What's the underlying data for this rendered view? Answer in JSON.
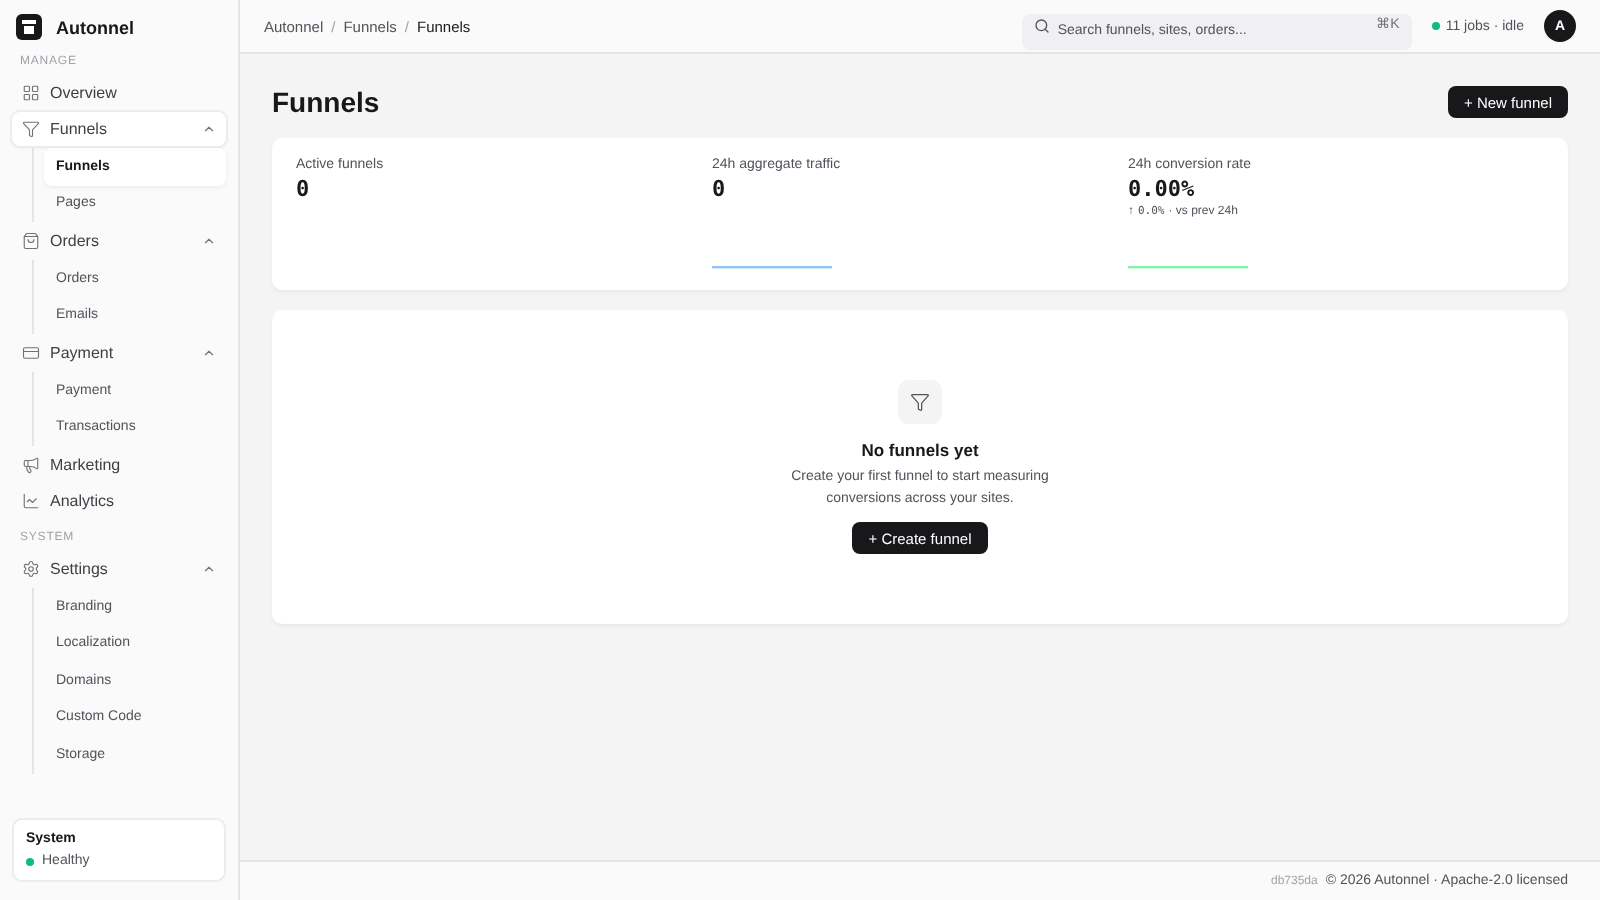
{
  "brand": {
    "name": "Autonnel"
  },
  "sidebar": {
    "sections": [
      {
        "title": "MANAGE",
        "items": [
          {
            "label": "Overview",
            "selected": false
          },
          {
            "label": "Funnels",
            "selected": true,
            "expanded": true,
            "children": [
              {
                "label": "Funnels",
                "selected": true
              },
              {
                "label": "Pages",
                "selected": false
              }
            ]
          },
          {
            "label": "Orders",
            "selected": false,
            "expanded": true,
            "children": [
              {
                "label": "Orders",
                "selected": false
              },
              {
                "label": "Emails",
                "selected": false
              }
            ]
          },
          {
            "label": "Payment",
            "selected": false,
            "expanded": true,
            "children": [
              {
                "label": "Payment",
                "selected": false
              },
              {
                "label": "Transactions",
                "selected": false
              }
            ]
          },
          {
            "label": "Marketing",
            "selected": false
          },
          {
            "label": "Analytics",
            "selected": false
          }
        ]
      },
      {
        "title": "SYSTEM",
        "items": [
          {
            "label": "Settings",
            "selected": false,
            "expanded": true,
            "children": [
              {
                "label": "Branding",
                "selected": false
              },
              {
                "label": "Localization",
                "selected": false
              },
              {
                "label": "Domains",
                "selected": false
              },
              {
                "label": "Custom Code",
                "selected": false
              },
              {
                "label": "Storage",
                "selected": false
              }
            ]
          }
        ]
      }
    ],
    "status_card": {
      "title": "System",
      "status": "Healthy",
      "color": "#10b981"
    }
  },
  "header": {
    "breadcrumbs": [
      "Autonnel",
      "Funnels",
      "Funnels"
    ],
    "breadcrumb_separator": "/",
    "search": {
      "placeholder": "Search funnels, sites, orders...",
      "shortcut": "⌘K"
    },
    "jobs": {
      "text": "11 jobs · idle",
      "color": "#10b981"
    },
    "avatar": "A"
  },
  "page": {
    "title": "Funnels",
    "action": "+ New funnel"
  },
  "metrics": [
    {
      "label": "Active funnels",
      "value": "0"
    },
    {
      "label": "24h aggregate traffic",
      "value": "0",
      "sparkline": {
        "color": "#93c5fd"
      }
    },
    {
      "label": "24h conversion rate",
      "value": "0.00%",
      "delta": {
        "arrow": "↑",
        "value": "0.0%",
        "text": "· vs prev 24h"
      },
      "sparkline": {
        "color": "#86efac"
      }
    }
  ],
  "empty_state": {
    "title": "No funnels yet",
    "text": "Create your first funnel to start measuring conversions across your sites.",
    "action": "+ Create funnel"
  },
  "footer": {
    "build": "db735da",
    "text": "© 2026 Autonnel · Apache-2.0 licensed"
  }
}
